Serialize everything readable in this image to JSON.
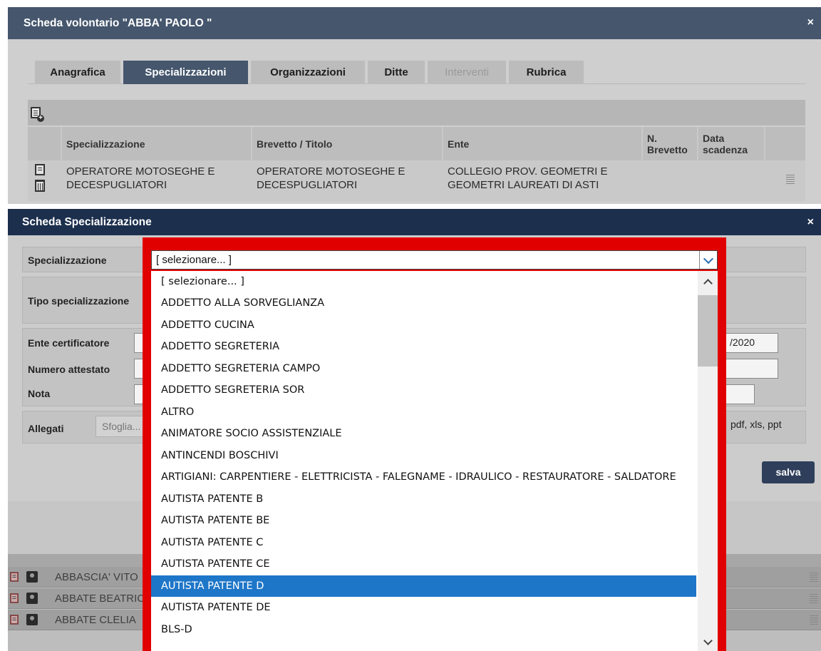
{
  "volunteer_dialog": {
    "title": "Scheda volontario \"ABBA' PAOLO \"",
    "close_glyph": "×",
    "tabs": [
      {
        "label": "Anagrafica",
        "state": "normal"
      },
      {
        "label": "Specializzazioni",
        "state": "active"
      },
      {
        "label": "Organizzazioni",
        "state": "normal"
      },
      {
        "label": "Ditte",
        "state": "normal"
      },
      {
        "label": "Interventi",
        "state": "disabled"
      },
      {
        "label": "Rubrica",
        "state": "normal"
      }
    ],
    "table": {
      "columns": [
        "Specializzazione",
        "Brevetto / Titolo",
        "Ente",
        "N. Brevetto",
        "Data scadenza"
      ],
      "rows": [
        {
          "specializzazione": "OPERATORE MOTOSEGHE E DECESPUGLIATORI",
          "brevetto": "OPERATORE MOTOSEGHE E DECESPUGLIATORI",
          "ente": "COLLEGIO PROV. GEOMETRI E GEOMETRI LAUREATI DI ASTI",
          "n_brevetto": "",
          "data_scadenza": ""
        }
      ]
    }
  },
  "spec_dialog": {
    "title": "Scheda Specializzazione",
    "close_glyph": "×",
    "labels": {
      "specializzazione": "Specializzazione",
      "tipo": "Tipo specializzazione",
      "ente": "Ente certificatore",
      "numero": "Numero attestato",
      "nota": "Nota",
      "allegati": "Allegati"
    },
    "date_fragment": "/2020",
    "browse_label": "Sfoglia...",
    "file_types_fragment": "pdf, xls, ppt",
    "save_label": "salva"
  },
  "dropdown": {
    "selected_value": "[ selezionare... ]",
    "highlighted_option": "AUTISTA PATENTE D",
    "options": [
      "[ selezionare... ]",
      "ADDETTO ALLA SORVEGLIANZA",
      "ADDETTO CUCINA",
      "ADDETTO SEGRETERIA",
      "ADDETTO SEGRETERIA CAMPO",
      "ADDETTO SEGRETERIA SOR",
      "ALTRO",
      "ANIMATORE SOCIO ASSISTENZIALE",
      "ANTINCENDI BOSCHIVI",
      "ARTIGIANI: CARPENTIERE - ELETTRICISTA - FALEGNAME - IDRAULICO - RESTAURATORE - SALDATORE",
      "AUTISTA PATENTE B",
      "AUTISTA PATENTE BE",
      "AUTISTA PATENTE C",
      "AUTISTA PATENTE CE",
      "AUTISTA PATENTE D",
      "AUTISTA PATENTE DE",
      "BLS-D"
    ],
    "highlight_color": "#e10000"
  },
  "background_list": {
    "rows": [
      "ABBASCIA' VITO",
      "ABBATE BEATRICE",
      "ABBATE CLELIA"
    ]
  },
  "colors": {
    "titlebar": "#45566d",
    "spec_titlebar": "#1c2f4d",
    "active_tab": "#45566d",
    "option_highlight": "#1e76c8",
    "save_button": "#2f3f5b"
  }
}
